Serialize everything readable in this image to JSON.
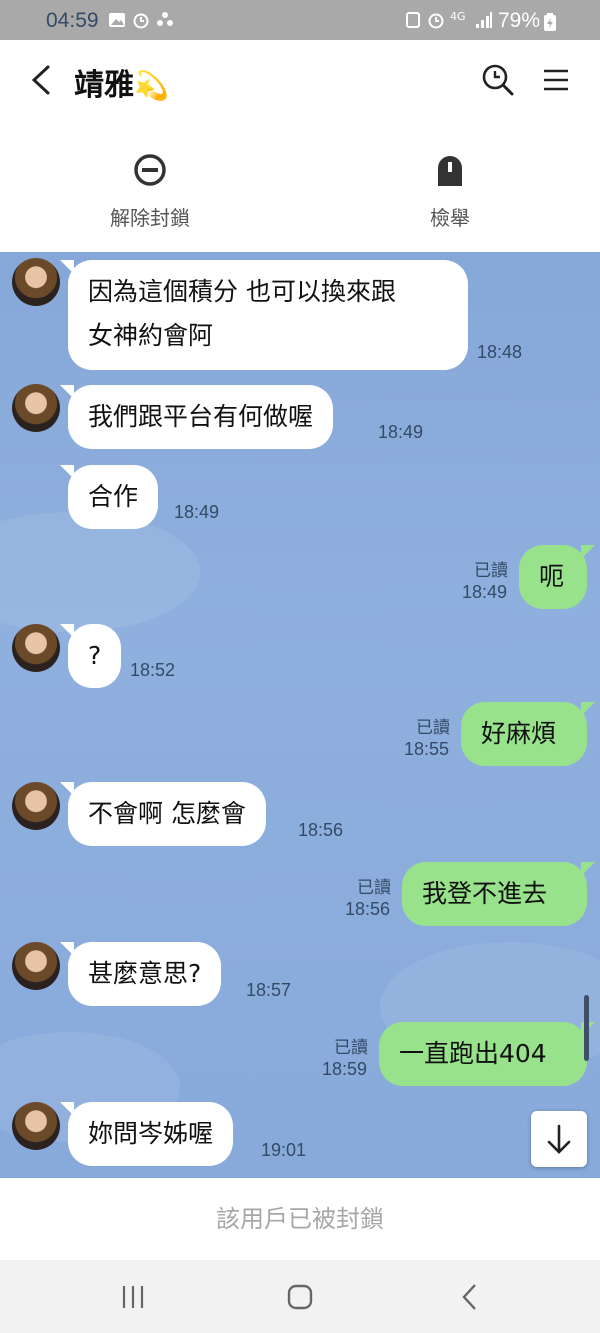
{
  "status_bar": {
    "time": "04:59",
    "battery": "79%",
    "network": "4G"
  },
  "header": {
    "contact_name": "靖雅",
    "contact_emoji": "💫"
  },
  "actions": {
    "unblock_label": "解除封鎖",
    "report_label": "檢舉"
  },
  "messages": [
    {
      "side": "in",
      "lines": [
        "因為這個積分 也可以換來跟",
        "女神約會阿"
      ],
      "time": "18:48"
    },
    {
      "side": "in",
      "lines": [
        "我們跟平台有何做喔"
      ],
      "time": "18:49"
    },
    {
      "side": "in",
      "lines": [
        "合作"
      ],
      "time": "18:49"
    },
    {
      "side": "out",
      "lines": [
        "呃"
      ],
      "time": "18:49",
      "read": "已讀"
    },
    {
      "side": "in",
      "lines": [
        "?"
      ],
      "time": "18:52"
    },
    {
      "side": "out",
      "lines": [
        "好麻煩"
      ],
      "time": "18:55",
      "read": "已讀"
    },
    {
      "side": "in",
      "lines": [
        "不會啊 怎麼會"
      ],
      "time": "18:56"
    },
    {
      "side": "out",
      "lines": [
        "我登不進去"
      ],
      "time": "18:56",
      "read": "已讀"
    },
    {
      "side": "in",
      "lines": [
        "甚麼意思?"
      ],
      "time": "18:57"
    },
    {
      "side": "out",
      "lines": [
        "一直跑出404"
      ],
      "time": "18:59",
      "read": "已讀"
    },
    {
      "side": "in",
      "lines": [
        "妳問岑姊喔"
      ],
      "time": "19:01"
    }
  ],
  "footer": {
    "blocked_notice": "該用戶已被封鎖"
  },
  "icons": {
    "back": "chevron-left-icon",
    "search": "clock-search-icon",
    "menu": "hamburger-menu-icon",
    "unblock": "minus-circle-icon",
    "report": "report-ghost-icon",
    "scroll_down": "arrow-down-icon"
  },
  "colors": {
    "chat_bg": "#88aadb",
    "outgoing_bubble": "#97e28b",
    "incoming_bubble": "#ffffff",
    "status_bar": "#a9a9a9"
  }
}
